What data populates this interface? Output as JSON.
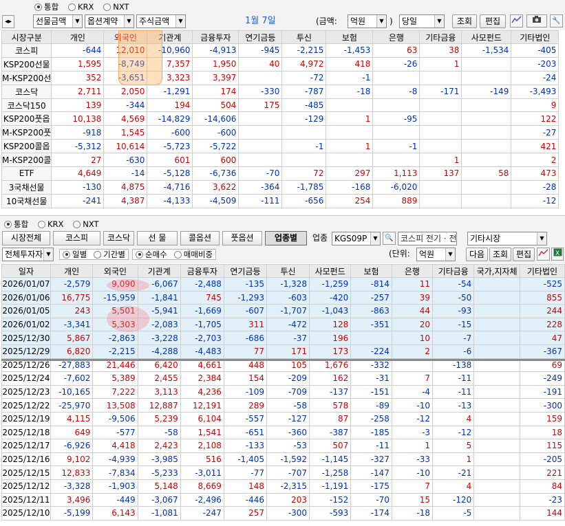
{
  "top": {
    "markets": [
      "통합",
      "KRX",
      "NXT"
    ],
    "market_selected": 0,
    "sel1": "선물금액",
    "sel2": "옵션계약",
    "sel3": "주식금액",
    "date_label": "1월 7일",
    "amount_label": "(금액:",
    "amount_unit": "억원",
    "close_paren": ")",
    "period": "당일",
    "query_btn": "조회",
    "edit_btn": "편집"
  },
  "summary": {
    "headers": [
      "시장구분",
      "개인",
      "외국인",
      "기관계",
      "금융투자",
      "연기금등",
      "투신",
      "보험",
      "은행",
      "기타금융",
      "사모펀드",
      "기타법인"
    ],
    "rows": [
      {
        "label": "코스피",
        "v": [
          "-644",
          "12,010",
          "-10,960",
          "-4,913",
          "-945",
          "-2,215",
          "-1,453",
          "63",
          "38",
          "-1,534",
          "-405"
        ]
      },
      {
        "label": "KSP200선물",
        "v": [
          "1,595",
          "-8,749",
          "7,357",
          "1,950",
          "40",
          "4,972",
          "418",
          "-26",
          "1",
          "",
          "-203"
        ]
      },
      {
        "label": "M-KSP200선",
        "v": [
          "352",
          "-3,651",
          "3,323",
          "3,397",
          "",
          "-72",
          "-1",
          "",
          "",
          "",
          "-24"
        ]
      },
      {
        "label": "코스닥",
        "v": [
          "2,711",
          "2,050",
          "-1,291",
          "174",
          "-330",
          "-787",
          "-18",
          "-8",
          "-171",
          "-149",
          "-3,493"
        ]
      },
      {
        "label": "코스닥150",
        "v": [
          "139",
          "-344",
          "194",
          "504",
          "175",
          "-485",
          "",
          "",
          "",
          "",
          "9"
        ]
      },
      {
        "label": "KSP200풋옵",
        "v": [
          "10,138",
          "4,569",
          "-14,829",
          "-14,606",
          "",
          "-129",
          "1",
          "-95",
          "",
          "",
          "122"
        ]
      },
      {
        "label": "M-KSP200풋",
        "v": [
          "-918",
          "1,545",
          "-600",
          "-600",
          "",
          "",
          "",
          "",
          "",
          "",
          "-27"
        ]
      },
      {
        "label": "KSP200콜옵",
        "v": [
          "-5,312",
          "10,614",
          "-5,723",
          "-5,722",
          "",
          "-1",
          "1",
          "-1",
          "",
          "",
          "421"
        ]
      },
      {
        "label": "M-KSP200콜",
        "v": [
          "27",
          "-630",
          "601",
          "600",
          "",
          "",
          "",
          "",
          "1",
          "",
          "2"
        ]
      },
      {
        "label": "ETF",
        "v": [
          "4,649",
          "-14",
          "-5,128",
          "-6,736",
          "-70",
          "72",
          "297",
          "1,113",
          "137",
          "58",
          "473"
        ]
      },
      {
        "label": "3국채선물",
        "v": [
          "-130",
          "4,875",
          "-4,716",
          "3,622",
          "-364",
          "-1,785",
          "-168",
          "-6,020",
          "",
          "",
          "-28"
        ]
      },
      {
        "label": "10국채선물",
        "v": [
          "-241",
          "4,387",
          "-4,133",
          "-4,509",
          "-111",
          "-656",
          "254",
          "889",
          "",
          "",
          "-12"
        ]
      }
    ]
  },
  "mid": {
    "markets": [
      "통합",
      "KRX",
      "NXT"
    ],
    "tabs": [
      "시장전체",
      "코스피",
      "코스닥",
      "선 물",
      "콜옵션",
      "풋옵션",
      "업종별"
    ],
    "active_tab": 6,
    "sector_label": "업종",
    "sector_code": "KGS09P",
    "sector_name": "코스피 전기 · 전",
    "other_market": "기타시장",
    "investor": "전체투자자",
    "period_opts": [
      "일별",
      "기간별"
    ],
    "buy_opts": [
      "순매수",
      "매매비중"
    ],
    "unit_label": "(단위:",
    "unit": "억원",
    "btn_next": "다음",
    "btn_query": "조회",
    "btn_edit": "편집"
  },
  "daily": {
    "headers": [
      "일자",
      "개인",
      "외국인",
      "기관계",
      "금융투자",
      "연기금등",
      "투신",
      "사모펀드",
      "보험",
      "은행",
      "기타금융",
      "국가,지자체",
      "기타법인"
    ],
    "rows": [
      [
        "2026/01/07",
        "-2,579",
        "9,090",
        "-6,067",
        "-2,488",
        "-135",
        "-1,328",
        "-1,259",
        "-814",
        "11",
        "-54",
        "",
        "-525"
      ],
      [
        "2026/01/06",
        "16,775",
        "-15,959",
        "-1,841",
        "745",
        "-1,293",
        "-603",
        "-420",
        "-257",
        "39",
        "-50",
        "",
        "855"
      ],
      [
        "2026/01/05",
        "243",
        "5,501",
        "-5,941",
        "-1,669",
        "-607",
        "-1,707",
        "-1,043",
        "-863",
        "44",
        "-93",
        "",
        "244"
      ],
      [
        "2026/01/02",
        "-3,341",
        "5,303",
        "-2,083",
        "-1,705",
        "311",
        "-472",
        "128",
        "-351",
        "20",
        "-15",
        "",
        "228"
      ],
      [
        "2025/12/30",
        "5,867",
        "-2,863",
        "-3,228",
        "-2,703",
        "-686",
        "-37",
        "196",
        "",
        "10",
        "-7",
        "",
        "47"
      ],
      [
        "2025/12/29",
        "6,820",
        "-2,215",
        "-4,288",
        "-4,483",
        "77",
        "171",
        "173",
        "-224",
        "2",
        "-6",
        "",
        "-367"
      ],
      [
        "2025/12/26",
        "-27,883",
        "21,446",
        "6,420",
        "4,661",
        "448",
        "105",
        "1,676",
        "-332",
        "",
        "-138",
        "",
        "69"
      ],
      [
        "2025/12/24",
        "-7,602",
        "5,389",
        "2,455",
        "2,384",
        "154",
        "-209",
        "162",
        "-31",
        "7",
        "-11",
        "",
        "-249"
      ],
      [
        "2025/12/23",
        "-10,165",
        "7,222",
        "3,113",
        "4,236",
        "-109",
        "-709",
        "-137",
        "-151",
        "-4",
        "-11",
        "",
        "-191"
      ],
      [
        "2025/12/22",
        "-25,970",
        "13,508",
        "12,887",
        "12,191",
        "289",
        "-58",
        "578",
        "-89",
        "-10",
        "-13",
        "",
        "-300"
      ],
      [
        "2025/12/19",
        "4,115",
        "-9,506",
        "5,239",
        "6,104",
        "-557",
        "-127",
        "87",
        "-258",
        "-12",
        "4",
        "",
        "159"
      ],
      [
        "2025/12/18",
        "649",
        "-577",
        "-58",
        "1,541",
        "-651",
        "-360",
        "-387",
        "-185",
        "-3",
        "-12",
        "",
        "18"
      ],
      [
        "2025/12/17",
        "-6,926",
        "4,418",
        "2,423",
        "2,108",
        "-133",
        "-53",
        "507",
        "-11",
        "1",
        "5",
        "",
        "115"
      ],
      [
        "2025/12/16",
        "9,102",
        "-4,939",
        "-3,985",
        "516",
        "-1,405",
        "-1,592",
        "-1,145",
        "-327",
        "-33",
        "1",
        "",
        "-205"
      ],
      [
        "2025/12/15",
        "12,833",
        "-7,834",
        "-5,233",
        "-3,011",
        "-77",
        "-707",
        "-1,258",
        "-147",
        "-10",
        "-21",
        "",
        "221"
      ],
      [
        "2025/12/12",
        "-3,328",
        "-1,903",
        "5,148",
        "8,669",
        "148",
        "-2,315",
        "-1,191",
        "-175",
        "7",
        "4",
        "",
        "84"
      ],
      [
        "2025/12/11",
        "3,496",
        "-449",
        "-3,067",
        "-2,496",
        "-446",
        "203",
        "-152",
        "-70",
        "15",
        "-120",
        "",
        "-23"
      ],
      [
        "2025/12/10",
        "-5,199",
        "6,143",
        "-1,081",
        "-247",
        "257",
        "-300",
        "-593",
        "-174",
        "-18",
        "-5",
        "",
        "144"
      ]
    ]
  }
}
